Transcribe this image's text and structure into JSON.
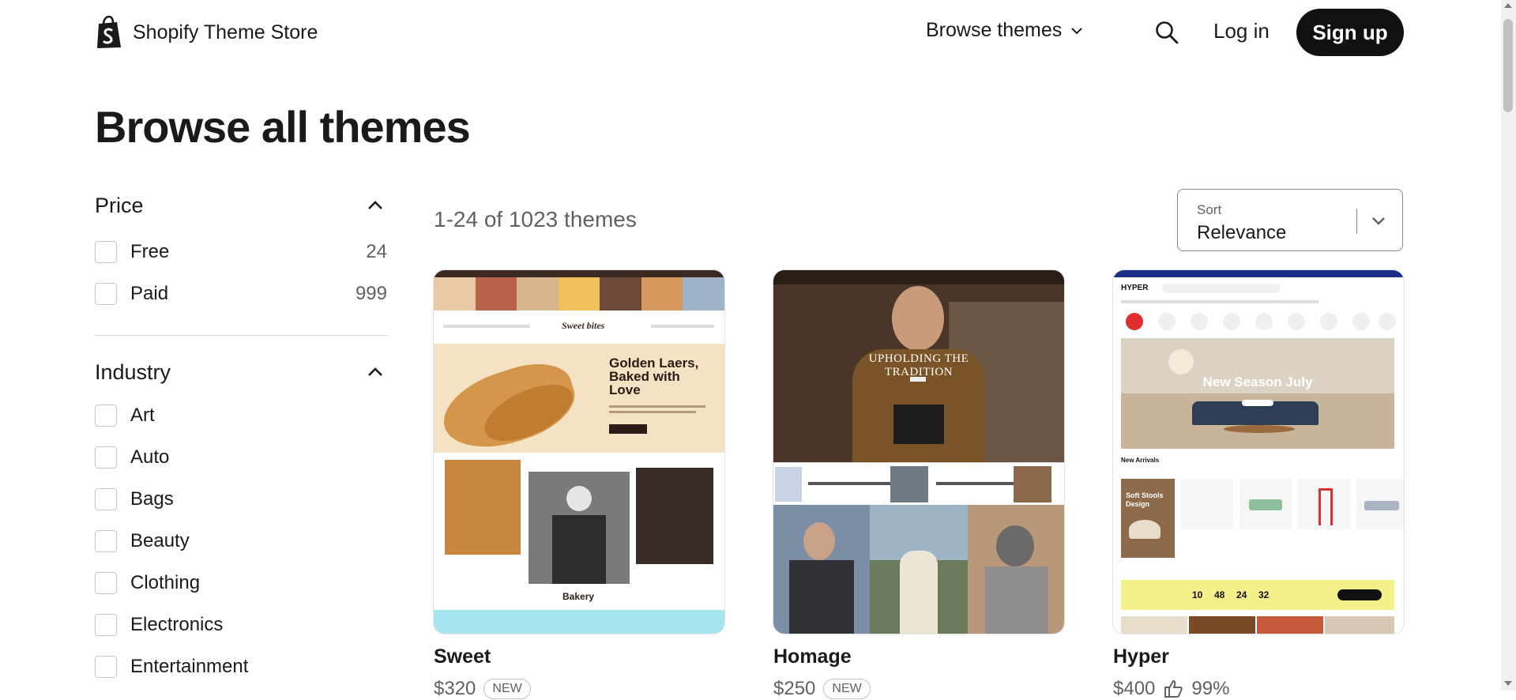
{
  "header": {
    "brand": "Shopify Theme Store",
    "browse_label": "Browse themes",
    "login_label": "Log in",
    "signup_label": "Sign up"
  },
  "page": {
    "title": "Browse all themes"
  },
  "filters": {
    "price": {
      "title": "Price",
      "options": [
        {
          "label": "Free",
          "count": "24"
        },
        {
          "label": "Paid",
          "count": "999"
        }
      ]
    },
    "industry": {
      "title": "Industry",
      "options": [
        {
          "label": "Art"
        },
        {
          "label": "Auto"
        },
        {
          "label": "Bags"
        },
        {
          "label": "Beauty"
        },
        {
          "label": "Clothing"
        },
        {
          "label": "Electronics"
        },
        {
          "label": "Entertainment"
        }
      ]
    }
  },
  "results": {
    "count_text": "1-24 of 1023 themes"
  },
  "sort": {
    "label": "Sort",
    "value": "Relevance"
  },
  "themes": [
    {
      "name": "Sweet",
      "price": "$320",
      "badge": "NEW",
      "preview": {
        "logo": "Sweet bites",
        "headline": "Golden Laers, Baked with Love",
        "section": "Bakery"
      }
    },
    {
      "name": "Homage",
      "price": "$250",
      "badge": "NEW",
      "preview": {
        "headline": "UPHOLDING THE TRADITION"
      }
    },
    {
      "name": "Hyper",
      "price": "$400",
      "rating": "99%",
      "preview": {
        "logo": "HYPER",
        "headline": "New Season July",
        "section": "New Arrivals",
        "promo": "Soft Stools Design",
        "countdown": [
          "10",
          "48",
          "24",
          "32"
        ]
      }
    }
  ],
  "colors": {
    "ink": "#1a1a1a",
    "muted": "#616161",
    "signup_bg": "#111111",
    "hyper_accent": "#e02d2d",
    "hyper_countdown": "#f4f08a"
  },
  "icons": {
    "logo": "shopify-bag-icon",
    "search": "search-icon",
    "browse_chevron": "chevron-down-icon",
    "section_toggle": "chevron-up-icon",
    "sort_chevron": "chevron-down-icon",
    "rating": "thumbs-up-icon"
  }
}
